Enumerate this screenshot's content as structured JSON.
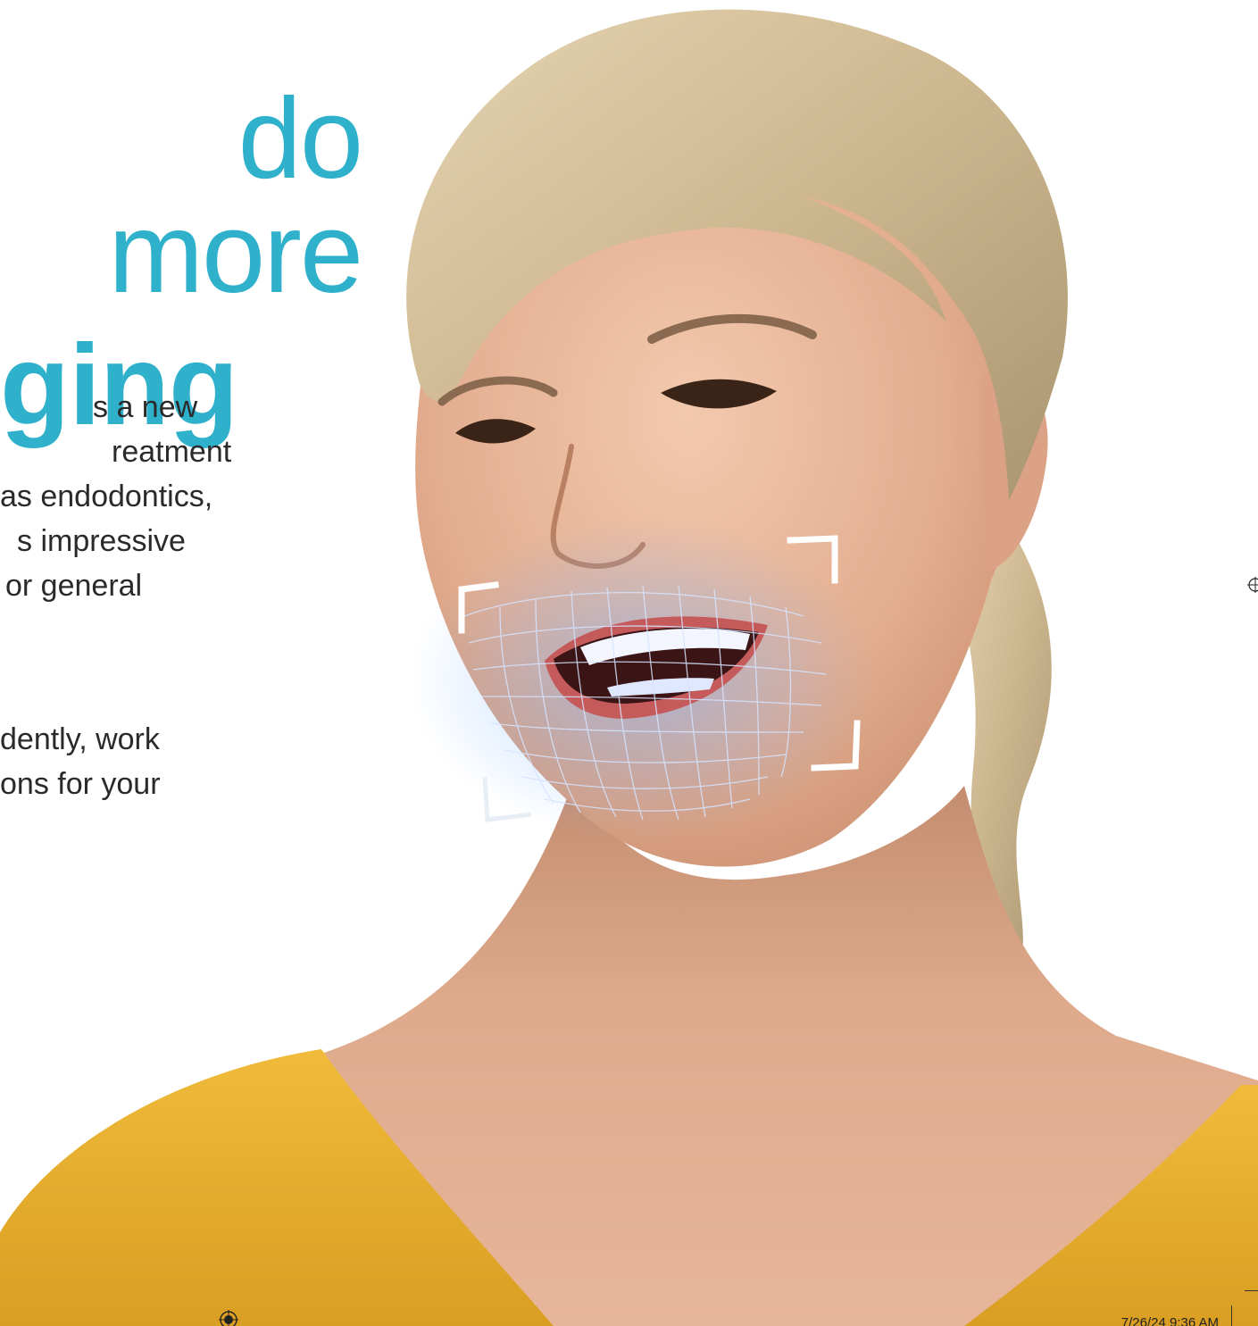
{
  "headline": {
    "line1": "do more",
    "line2": "ging"
  },
  "paragraph1": {
    "lines": [
      "s a new",
      "reatment",
      "as endodontics,",
      "s impressive",
      "or general"
    ]
  },
  "paragraph2": {
    "lines": [
      "dently, work",
      "ons for your"
    ]
  },
  "footer": {
    "timestamp": "7/26/24   9:36 AM"
  },
  "colors": {
    "accent": "#2fb1cb",
    "sweater": "#e8b12f",
    "skin": "#e9b89e",
    "hair": "#d8c39c",
    "scan_grid": "#8fb8ff"
  }
}
